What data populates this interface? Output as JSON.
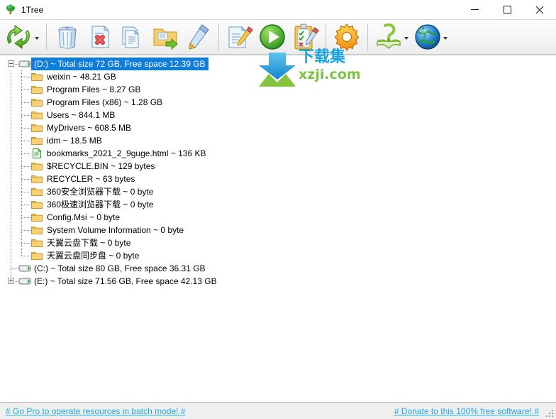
{
  "window": {
    "title": "1Tree",
    "app_icon": "tree-icon",
    "controls": [
      {
        "name": "minimize-button",
        "glyph": "—"
      },
      {
        "name": "maximize-button",
        "glyph": "☐"
      },
      {
        "name": "close-button",
        "glyph": "✕"
      }
    ]
  },
  "toolbar": {
    "items": [
      {
        "name": "refresh-scan-button",
        "icon": "refresh-arrows-icon",
        "caret": true,
        "sep_after": true
      },
      {
        "name": "recycle-bin-button",
        "icon": "trash-bin-icon",
        "caret": false,
        "sep_after": false
      },
      {
        "name": "delete-file-button",
        "icon": "file-delete-icon",
        "caret": false,
        "sep_after": false
      },
      {
        "name": "copy-list-button",
        "icon": "documents-copy-icon",
        "caret": false,
        "sep_after": false
      },
      {
        "name": "move-folder-button",
        "icon": "folder-move-icon",
        "caret": false,
        "sep_after": false
      },
      {
        "name": "rename-button",
        "icon": "pencil-edit-icon",
        "caret": false,
        "sep_after": true
      },
      {
        "name": "edit-report-button",
        "icon": "document-pencil-icon",
        "caret": false,
        "sep_after": false
      },
      {
        "name": "run-scan-button",
        "icon": "play-green-icon",
        "caret": false,
        "sep_after": false
      },
      {
        "name": "checklist-button",
        "icon": "clipboard-check-icon",
        "caret": false,
        "sep_after": true
      },
      {
        "name": "settings-button",
        "icon": "gear-orange-icon",
        "caret": false,
        "sep_after": true
      },
      {
        "name": "help-button",
        "icon": "question-book-icon",
        "caret": true,
        "sep_after": false
      },
      {
        "name": "website-button",
        "icon": "globe-icon",
        "caret": true,
        "sep_after": false
      }
    ]
  },
  "watermark": {
    "text_cn": "下载集",
    "text_en": "xzji.com",
    "icon": "download-arrow-icon"
  },
  "tree": {
    "nodes": [
      {
        "level": 0,
        "icon": "drive-icon",
        "expander": "minus",
        "selected": true,
        "label": "(D:) ~ Total size 72 GB, Free space 12.39 GB"
      },
      {
        "level": 1,
        "icon": "folder-icon",
        "expander": "none",
        "selected": false,
        "label": "weixin ~ 48.21 GB"
      },
      {
        "level": 1,
        "icon": "folder-icon",
        "expander": "none",
        "selected": false,
        "label": "Program Files ~ 8.27 GB"
      },
      {
        "level": 1,
        "icon": "folder-icon",
        "expander": "none",
        "selected": false,
        "label": "Program Files (x86) ~ 1.28 GB"
      },
      {
        "level": 1,
        "icon": "folder-icon",
        "expander": "none",
        "selected": false,
        "label": "Users ~ 844.1 MB"
      },
      {
        "level": 1,
        "icon": "folder-icon",
        "expander": "none",
        "selected": false,
        "label": "MyDrivers ~ 608.5 MB"
      },
      {
        "level": 1,
        "icon": "folder-icon",
        "expander": "none",
        "selected": false,
        "label": "idm ~ 18.5 MB"
      },
      {
        "level": 1,
        "icon": "html-file-icon",
        "expander": "none",
        "selected": false,
        "label": "bookmarks_2021_2_9guge.html ~ 136 KB"
      },
      {
        "level": 1,
        "icon": "folder-icon",
        "expander": "none",
        "selected": false,
        "label": "$RECYCLE.BIN ~ 129 bytes"
      },
      {
        "level": 1,
        "icon": "folder-icon",
        "expander": "none",
        "selected": false,
        "label": "RECYCLER ~ 63 bytes"
      },
      {
        "level": 1,
        "icon": "folder-icon",
        "expander": "none",
        "selected": false,
        "label": "360安全浏览器下载 ~ 0 byte"
      },
      {
        "level": 1,
        "icon": "folder-icon",
        "expander": "none",
        "selected": false,
        "label": "360极速浏览器下载 ~ 0 byte"
      },
      {
        "level": 1,
        "icon": "folder-icon",
        "expander": "none",
        "selected": false,
        "label": "Config.Msi ~ 0 byte"
      },
      {
        "level": 1,
        "icon": "folder-icon",
        "expander": "none",
        "selected": false,
        "label": "System Volume Information ~ 0 byte"
      },
      {
        "level": 1,
        "icon": "folder-icon",
        "expander": "none",
        "selected": false,
        "label": "天翼云盘下载 ~ 0 byte"
      },
      {
        "level": 1,
        "icon": "folder-icon",
        "expander": "none",
        "selected": false,
        "label": "天翼云盘同步盘 ~ 0 byte"
      },
      {
        "level": 0,
        "icon": "drive-icon",
        "expander": "none",
        "selected": false,
        "label": "(C:) ~ Total size 80 GB, Free space 36.31 GB"
      },
      {
        "level": 0,
        "icon": "drive-icon",
        "expander": "plus",
        "selected": false,
        "label": "(E:) ~ Total size 71.56 GB, Free space 42.13 GB"
      }
    ]
  },
  "statusbar": {
    "left_link": "# Go Pro to operate resources in batch mode! #",
    "right_link": "# Donate to this 100% free software! #"
  },
  "colors": {
    "selection": "#0f7ddb",
    "link": "#1fa8e8",
    "folder": "#f0c055",
    "watermark_blue": "#19a2e0",
    "watermark_green": "#7cc243"
  }
}
